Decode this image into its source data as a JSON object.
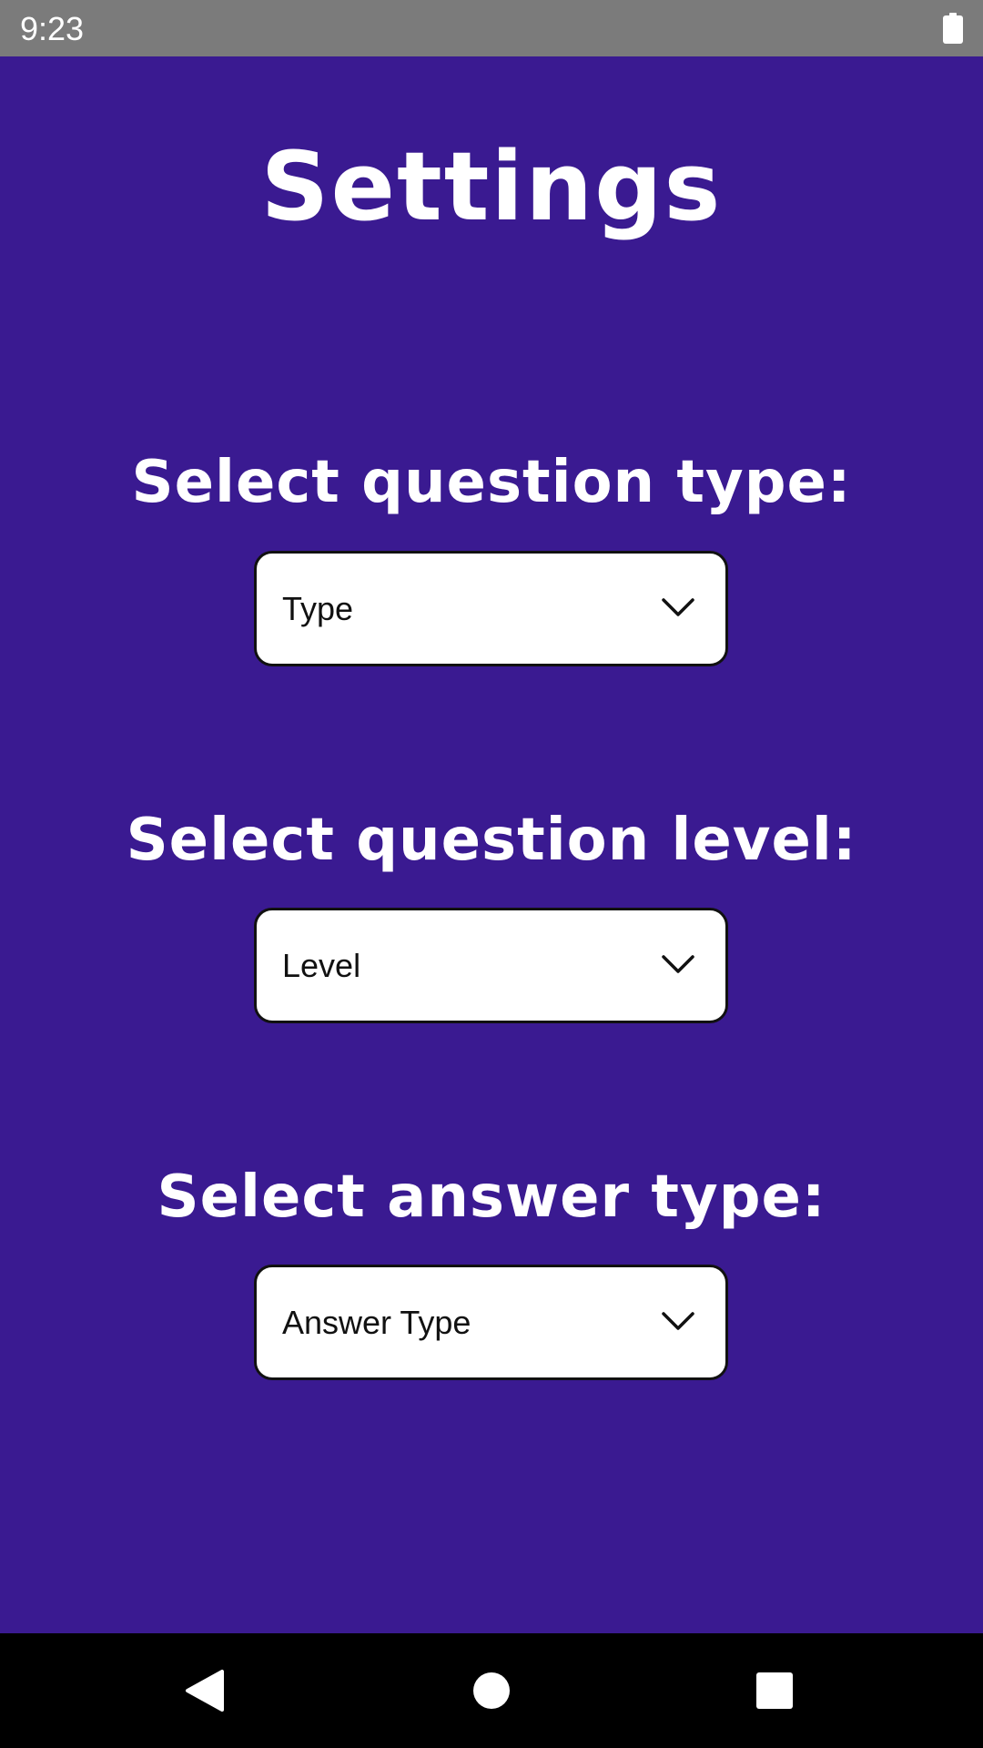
{
  "status_bar": {
    "time": "9:23",
    "battery_icon": "battery-full-icon"
  },
  "page": {
    "title": "Settings",
    "background_color": "#3a1a91"
  },
  "settings": [
    {
      "label": "Select question type:",
      "dropdown_value": "Type"
    },
    {
      "label": "Select question level:",
      "dropdown_value": "Level"
    },
    {
      "label": "Select answer type:",
      "dropdown_value": "Answer Type"
    }
  ],
  "nav_bar": {
    "back_icon": "back-triangle-icon",
    "home_icon": "home-circle-icon",
    "recents_icon": "recents-square-icon"
  }
}
